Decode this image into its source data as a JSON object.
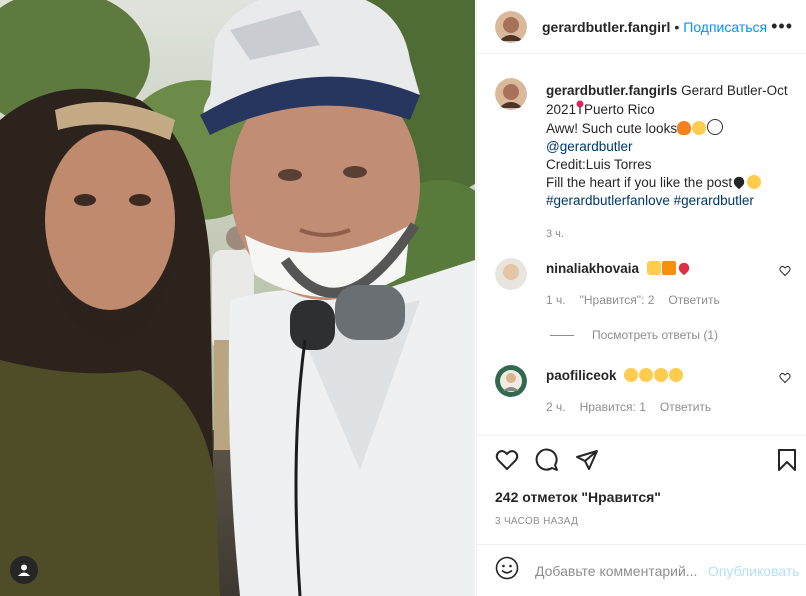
{
  "post": {
    "username": "gerardbutler.fangirl",
    "follow_label": "Подписаться",
    "dot": "•",
    "more": "•••"
  },
  "caption": {
    "username": "gerardbutler.fangirls",
    "line1": "Gerard Butler-Oct 2021",
    "place": "Puerto Rico",
    "line2": "Aww! Such cute looks",
    "mention": "@gerardbutler",
    "credit": "Credit:Luis Torres",
    "line3": "Fill the heart if you like the post",
    "hashtags": "#gerardbutlerfanlove #gerardbutler",
    "time": "3 ч."
  },
  "comments": [
    {
      "username": "ninaliakhovaia",
      "time": "1 ч.",
      "likes": "\"Нравится\": 2",
      "reply": "Ответить"
    },
    {
      "username": "paofiliceok",
      "time": "2 ч.",
      "likes": "Нравится: 1",
      "reply": "Ответить"
    }
  ],
  "replies_label": "Посмотреть ответы (1)",
  "likes_count": "242 отметок \"Нравится\"",
  "post_time": "3 ЧАСОВ НАЗАД",
  "add_comment": {
    "placeholder": "Добавьте комментарий...",
    "publish": "Опубликовать"
  },
  "colors": {
    "accent": "#0095f6",
    "publish_disabled": "#b2dffc",
    "muted": "#8e8e8e",
    "text": "#262626"
  },
  "icons": [
    "more-icon",
    "heart-icon",
    "comment-icon",
    "share-icon",
    "bookmark-icon",
    "emoji-icon",
    "tag-user-icon"
  ]
}
